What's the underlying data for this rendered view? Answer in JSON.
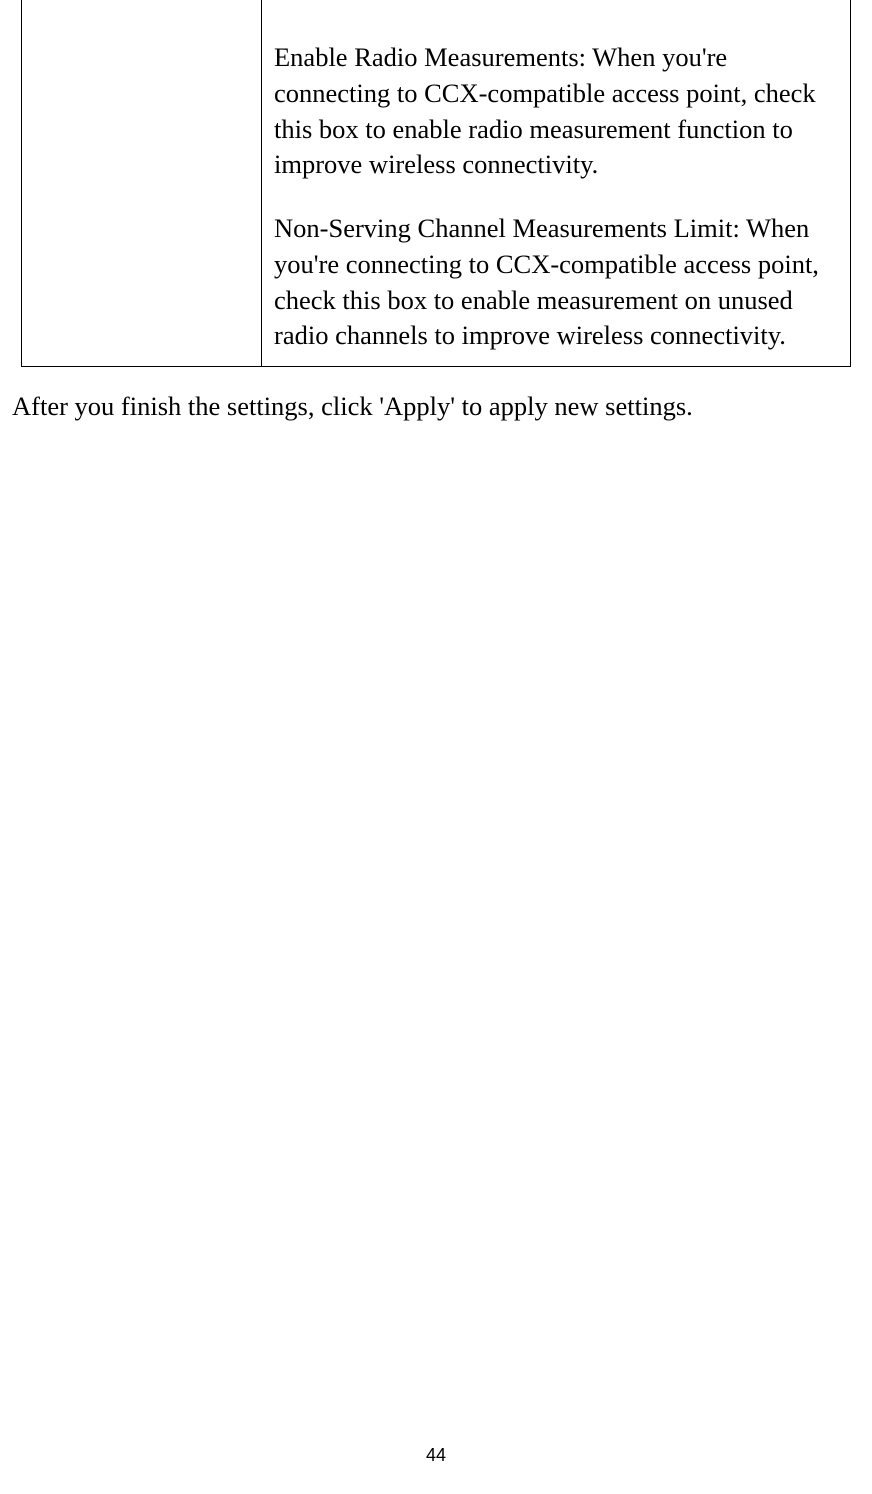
{
  "table": {
    "right": {
      "para1": "Enable Radio Measurements: When you're connecting to CCX-compatible access point, check this box to enable radio measurement function to improve wireless connectivity.",
      "para2": "Non-Serving Channel Measurements Limit: When you're connecting to CCX-compatible access point, check this box to enable measurement on unused radio channels to improve wireless connectivity."
    }
  },
  "body_paragraph": "After you finish the settings, click 'Apply' to apply new settings.",
  "page_number": "44"
}
